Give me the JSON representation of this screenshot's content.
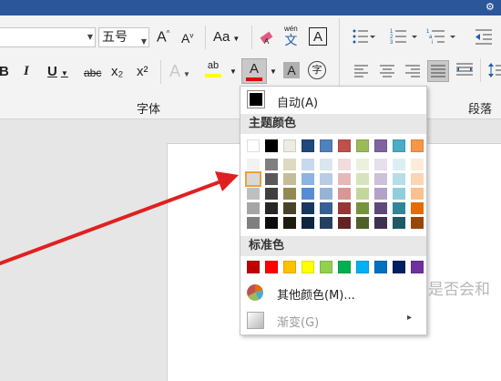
{
  "ribbon": {
    "font_size": "五号",
    "buttons": {
      "bold": "B",
      "italic": "I",
      "underline": "U",
      "strikethrough": "abc",
      "subscript": "x₂",
      "superscript": "x²",
      "grow_font": "A",
      "shrink_font": "A",
      "change_case": "Aa",
      "phonetic_top": "wén",
      "phonetic_char": "文",
      "char_border": "A",
      "text_effects": "A",
      "highlight": "ab",
      "font_color": "A",
      "char_shading": "A",
      "enclose_char": "字"
    },
    "group_font_label": "字体",
    "group_paragraph_label": "段落"
  },
  "document": {
    "visible_text": "是否会和"
  },
  "color_menu": {
    "automatic_label": "自动(A)",
    "theme_colors_header": "主题颜色",
    "theme_colors_base": [
      "#ffffff",
      "#000000",
      "#eeece1",
      "#1f497d",
      "#4f81bd",
      "#c0504d",
      "#9bbb59",
      "#8064a2",
      "#4bacc6",
      "#f79646"
    ],
    "theme_colors_shades": [
      [
        "#f2f2f2",
        "#7f7f7f",
        "#ddd9c3",
        "#c6d9f0",
        "#dbe5f1",
        "#f2dcdb",
        "#ebf1dd",
        "#e5e0ec",
        "#dbeef3",
        "#fdeada"
      ],
      [
        "#d8d8d8",
        "#595959",
        "#c4bd97",
        "#8db3e2",
        "#b8cce4",
        "#e5b9b7",
        "#d7e3bc",
        "#ccc1d9",
        "#b7dde8",
        "#fbd5b5"
      ],
      [
        "#bfbfbf",
        "#3f3f3f",
        "#938953",
        "#548dd4",
        "#95b3d7",
        "#d99694",
        "#c3d69b",
        "#b2a2c7",
        "#92cddc",
        "#fac08f"
      ],
      [
        "#a5a5a5",
        "#262626",
        "#494429",
        "#17365d",
        "#366092",
        "#953734",
        "#76923c",
        "#5f497a",
        "#31859b",
        "#e36c09"
      ],
      [
        "#7f7f7f",
        "#0c0c0c",
        "#1d1b10",
        "#0f243e",
        "#244061",
        "#632423",
        "#4f6128",
        "#3f3151",
        "#205867",
        "#974806"
      ]
    ],
    "standard_colors_header": "标准色",
    "standard_colors": [
      "#c00000",
      "#ff0000",
      "#ffc000",
      "#ffff00",
      "#92d050",
      "#00b050",
      "#00b0f0",
      "#0070c0",
      "#002060",
      "#7030a0"
    ],
    "more_colors_label": "其他颜色(M)...",
    "gradient_label": "渐变(G)",
    "gradient_arrow": "▸"
  },
  "annotation": {
    "arrow_color": "#e02020"
  }
}
